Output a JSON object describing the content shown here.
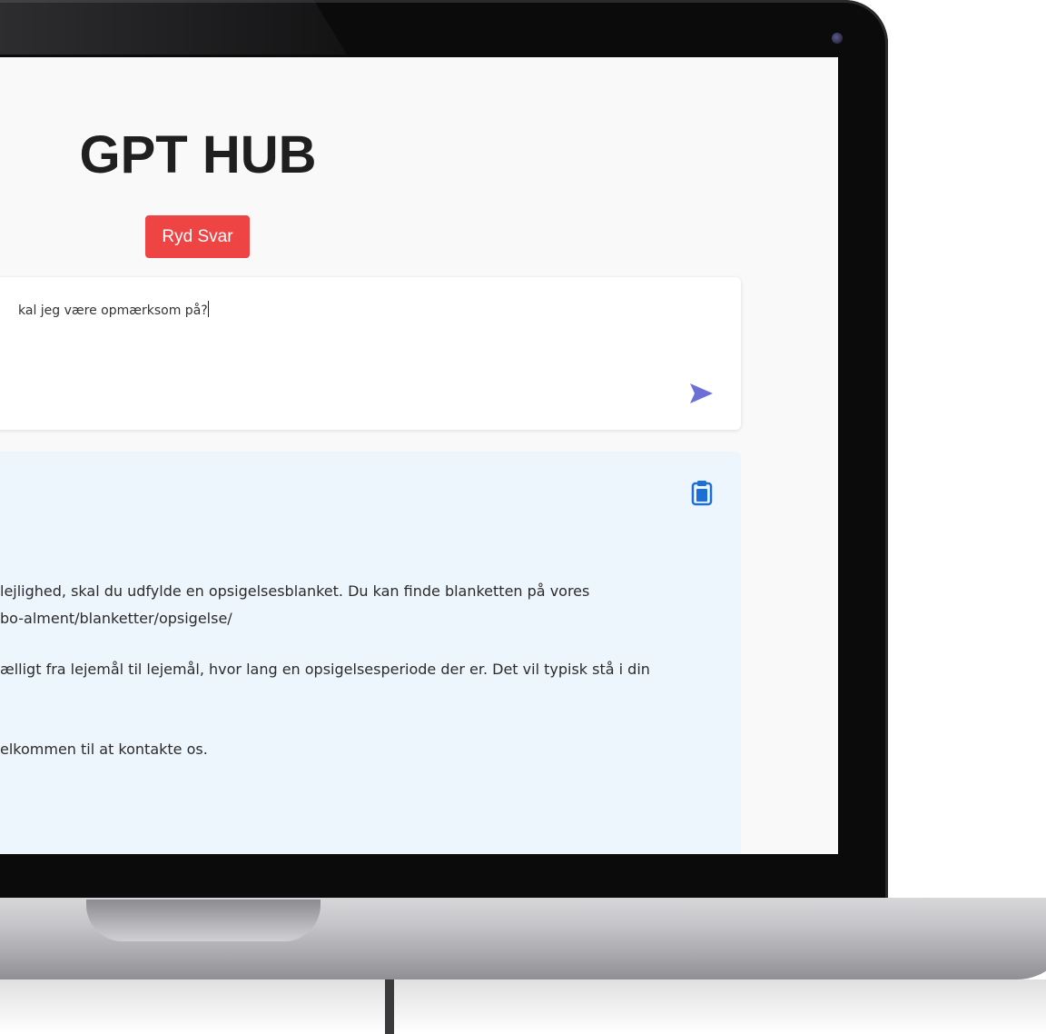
{
  "app": {
    "title": "GPT HUB",
    "clear_label": "Ryd Svar"
  },
  "query": {
    "text": "kal jeg være opmærksom på?"
  },
  "answer": {
    "lines": [
      " lejlighed, skal du udfylde en opsigelsesblanket. Du kan finde blanketten på vores",
      "bo-alment/blanketter/opsigelse/",
      "ælligt fra lejemål til lejemål, hvor lang en opsigelsesperiode der er. Det vil typisk stå i din",
      "elkommen til at kontakte os."
    ]
  },
  "icons": {
    "send": "paper-plane-icon",
    "copy": "clipboard-icon"
  },
  "colors": {
    "clear_button": "#ef4444",
    "send_icon": "#6b6fd6",
    "copy_icon": "#1d6fd6",
    "answer_bg": "#eef6fd"
  }
}
